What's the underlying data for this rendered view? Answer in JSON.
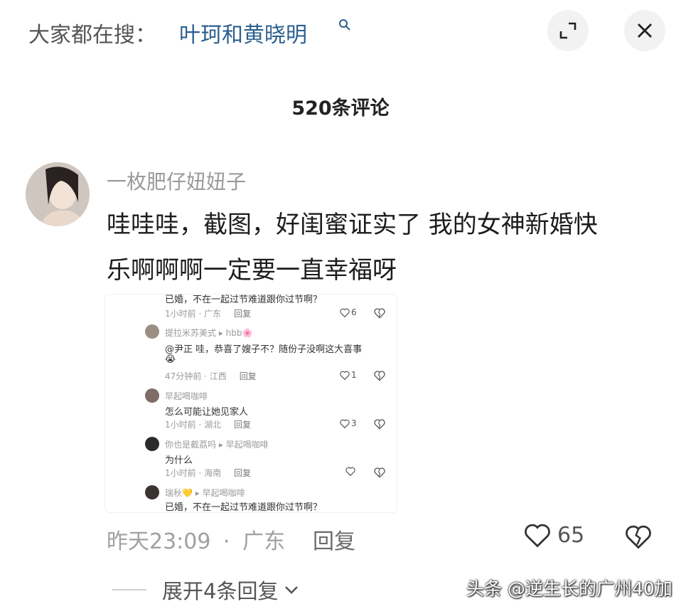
{
  "search": {
    "prefix": "大家都在搜：",
    "term": "叶珂和黄晓明"
  },
  "header": {
    "comment_count": "520条评论"
  },
  "comment": {
    "username": "一枚肥仔妞妞子",
    "text_line1": "哇哇哇，截图，好闺蜜证实了  我的女神新婚快",
    "text_line2": "乐啊啊啊一定要一直幸福呀",
    "time": "昨天23:09",
    "separator": "·",
    "location": "广东",
    "reply_label": "回复",
    "likes": "65",
    "expand_label": "展开4条回复"
  },
  "embedded_screenshot": {
    "top_text": "已婚，不在一起过节难道跟你过节啊？",
    "top_meta": "1小时前 · 广东",
    "top_reply": "回复",
    "top_likes": "6",
    "replies": [
      {
        "name": "提拉米苏美式 ▸ hbb🌸",
        "text": "@尹正 哇，恭喜了嫂子不？随份子没啊这大喜事",
        "emoji": "😭",
        "meta": "47分钟前 · 江西",
        "reply": "回复",
        "likes": "1"
      },
      {
        "name": "早起喝咖啡",
        "text": "怎么可能让她见家人",
        "meta": "1小时前 · 湖北",
        "reply": "回复",
        "likes": "3"
      },
      {
        "name": "你也是截荔吗 ▸ 早起喝咖啡",
        "text": "为什么",
        "meta": "1小时前 · 海南",
        "reply": "回复",
        "likes": ""
      },
      {
        "name": "瑞秋💛 ▸ 早起喝咖啡",
        "text": "已婚，不在一起过节难道跟你过节啊？"
      }
    ]
  },
  "watermark": "头条 @逆生长的广州40加",
  "colors": {
    "search_term": "#2d5f8f",
    "username": "#9a9a9a",
    "text": "#1c1c1c"
  },
  "icons": [
    "search-icon",
    "expand-icon",
    "close-icon",
    "heart-icon",
    "broken-heart-icon",
    "chevron-down-icon"
  ]
}
